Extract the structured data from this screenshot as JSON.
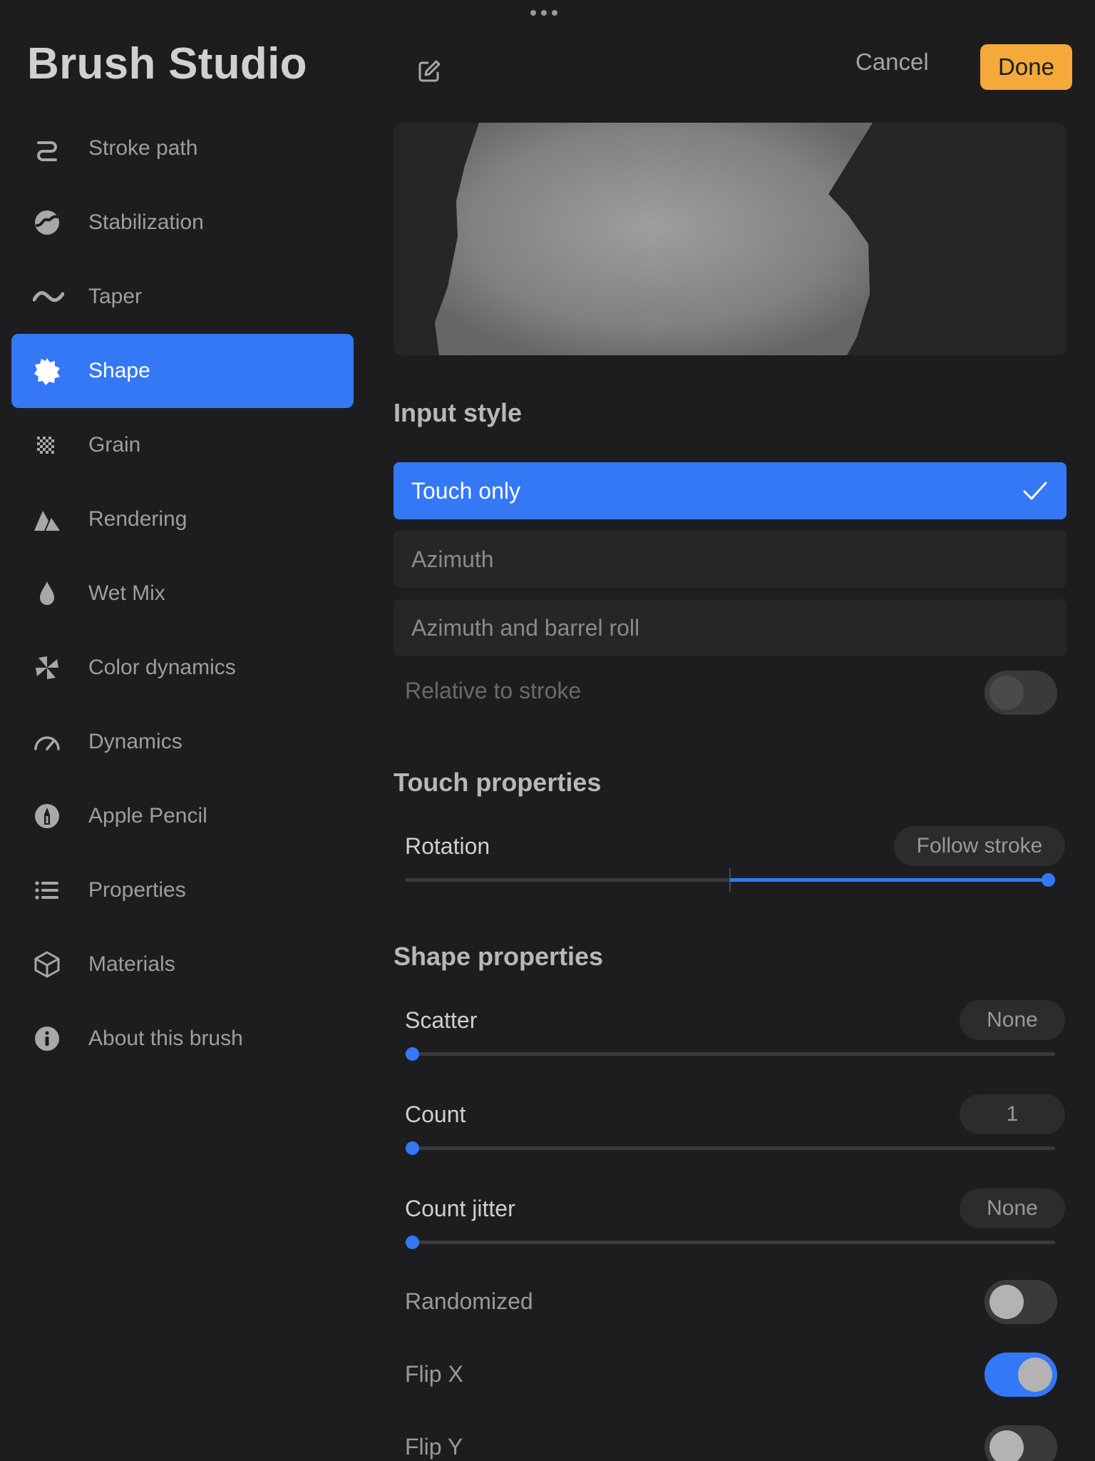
{
  "header": {
    "title": "Brush Studio",
    "cancel_label": "Cancel",
    "done_label": "Done"
  },
  "sidebar": {
    "items": [
      {
        "label": "Stroke path",
        "icon": "stroke-path-icon"
      },
      {
        "label": "Stabilization",
        "icon": "stabilization-icon"
      },
      {
        "label": "Taper",
        "icon": "taper-icon"
      },
      {
        "label": "Shape",
        "icon": "shape-icon",
        "active": true
      },
      {
        "label": "Grain",
        "icon": "grain-icon"
      },
      {
        "label": "Rendering",
        "icon": "rendering-icon"
      },
      {
        "label": "Wet Mix",
        "icon": "wet-mix-icon"
      },
      {
        "label": "Color dynamics",
        "icon": "color-dynamics-icon"
      },
      {
        "label": "Dynamics",
        "icon": "dynamics-icon"
      },
      {
        "label": "Apple Pencil",
        "icon": "apple-pencil-icon"
      },
      {
        "label": "Properties",
        "icon": "properties-icon"
      },
      {
        "label": "Materials",
        "icon": "materials-icon"
      },
      {
        "label": "About this brush",
        "icon": "info-icon"
      }
    ]
  },
  "input_style": {
    "heading": "Input style",
    "options": [
      "Touch only",
      "Azimuth",
      "Azimuth and barrel roll"
    ],
    "selected": "Touch only",
    "relative_to_stroke": {
      "label": "Relative to stroke",
      "enabled": false,
      "value": false
    }
  },
  "touch_properties": {
    "heading": "Touch properties",
    "rotation": {
      "label": "Rotation",
      "value": "Follow stroke",
      "position": 1.0
    }
  },
  "shape_properties": {
    "heading": "Shape properties",
    "scatter": {
      "label": "Scatter",
      "value": "None",
      "position": 0.0
    },
    "count": {
      "label": "Count",
      "value": "1",
      "position": 0.0
    },
    "count_jitter": {
      "label": "Count jitter",
      "value": "None",
      "position": 0.0
    },
    "randomized": {
      "label": "Randomized",
      "value": false
    },
    "flip_x": {
      "label": "Flip X",
      "value": true
    },
    "flip_y": {
      "label": "Flip Y",
      "value": false
    }
  },
  "colors": {
    "accent": "#3478f6",
    "done": "#f4a93a",
    "background": "#1d1d1f"
  }
}
